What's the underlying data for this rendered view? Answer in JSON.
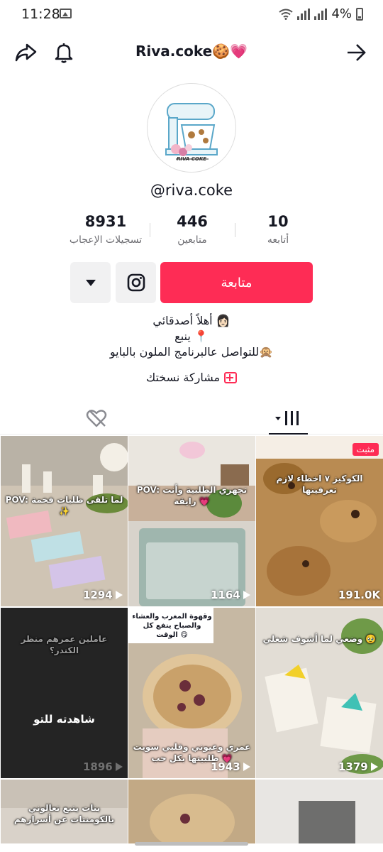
{
  "status": {
    "time": "11:28",
    "battery": "4%"
  },
  "header": {
    "title": "Riva.coke🍪💗"
  },
  "profile": {
    "username": "@riva.coke",
    "logo_text": "RIVA COKE"
  },
  "stats": [
    {
      "value": "10",
      "label": "أتابعه"
    },
    {
      "value": "446",
      "label": "متابعين"
    },
    {
      "value": "8931",
      "label": "تسجيلات الإعجاب"
    }
  ],
  "actions": {
    "follow_label": "متابعة"
  },
  "bio": {
    "line1": "أهلاً أصدقائي 👩🏻",
    "line2": "ينبع 📍",
    "line3": "للتواصل عالبرنامج الملون بالبايو🙊",
    "share": "مشاركة نسختك"
  },
  "videos": [
    {
      "views": "1294",
      "caption": "POV: لما تلقى طلبات فخمة ✨",
      "bg": "#cfc4b4"
    },
    {
      "views": "1164",
      "caption": "POV: تجهزي الطلبية وأنت رايقة 💗",
      "bg": "#c9c9c3"
    },
    {
      "views": "191.0K",
      "caption": "الكوكيز ٧ اخطاء لازم تعرفينها",
      "bg": "#b98b52",
      "pinned": "مثبت"
    },
    {
      "views": "1896",
      "caption": "عاملين عمرهم منظر الكندر؟",
      "bg": "#2c2c2c",
      "watched": "شاهدته للتو"
    },
    {
      "views": "1943",
      "caption": "عمري وعيوني وقلبي سويت طلبيتها بكل حب 💗",
      "bg": "#c6b8a3",
      "top_caption": "وقهوة المغرب والعشاء والصباح ينفع كل الوقت 😋"
    },
    {
      "views": "1379",
      "caption": "وضعي لما أشوف شغلي 🥹",
      "bg": "#e2ddd5"
    },
    {
      "views": "",
      "caption": "بنات يتبع تعالوني بالكومنتات عن أسرارهم",
      "bg": "#d9d2c9"
    },
    {
      "views": "",
      "caption": "",
      "bg": "#c2a985"
    },
    {
      "views": "",
      "caption": "",
      "bg": "#e8e6e3"
    }
  ]
}
